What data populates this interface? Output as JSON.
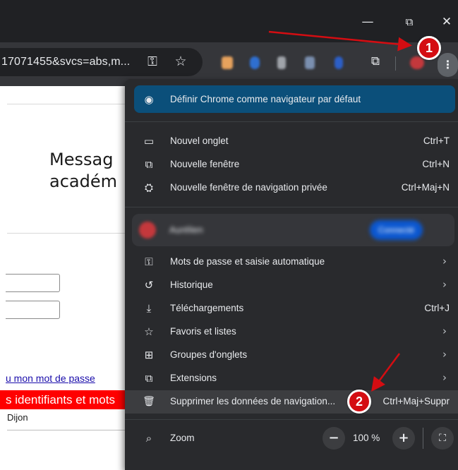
{
  "window": {
    "minimize_glyph": "—",
    "restore_glyph": "⧉",
    "close_glyph": "✕"
  },
  "toolbar": {
    "url_text": "17071455&svcs=abs,m...",
    "password_key_glyph": "⚿",
    "bookmark_star_glyph": "☆",
    "extensions_glyph": "⧉",
    "menu_glyph": "⋮"
  },
  "page": {
    "heading_line1": "Messag",
    "heading_line2": "académ",
    "forgot_link": "u mon mot de passe",
    "red_banner": "s identifiants et mots",
    "city": "Dijon"
  },
  "menu": {
    "set_default": {
      "label": "Définir Chrome comme navigateur par défaut",
      "icon": "chrome-icon",
      "glyph": "◉"
    },
    "group1": [
      {
        "label": "Nouvel onglet",
        "shortcut": "Ctrl+T",
        "icon": "new-tab-icon",
        "glyph": "▭"
      },
      {
        "label": "Nouvelle fenêtre",
        "shortcut": "Ctrl+N",
        "icon": "new-window-icon",
        "glyph": "⧉"
      },
      {
        "label": "Nouvelle fenêtre de navigation privée",
        "shortcut": "Ctrl+Maj+N",
        "icon": "incognito-icon",
        "glyph": "⛭"
      }
    ],
    "profile": {
      "name": "Aurélien",
      "status": "Connecté"
    },
    "group2": [
      {
        "label": "Mots de passe et saisie automatique",
        "icon": "key-icon",
        "glyph": "⚿",
        "chevron": "›"
      },
      {
        "label": "Historique",
        "icon": "history-icon",
        "glyph": "↺",
        "chevron": "›"
      },
      {
        "label": "Téléchargements",
        "shortcut": "Ctrl+J",
        "icon": "download-icon",
        "glyph": "⤓"
      },
      {
        "label": "Favoris et listes",
        "icon": "star-icon",
        "glyph": "☆",
        "chevron": "›"
      },
      {
        "label": "Groupes d'onglets",
        "icon": "tab-groups-icon",
        "glyph": "⊞",
        "chevron": "›"
      },
      {
        "label": "Extensions",
        "icon": "puzzle-icon",
        "glyph": "⧉",
        "chevron": "›"
      },
      {
        "label": "Supprimer les données de navigation...",
        "shortcut": "Ctrl+Maj+Suppr",
        "icon": "trash-icon",
        "glyph": "🗑"
      }
    ],
    "zoom": {
      "label": "Zoom",
      "value": "100 %",
      "minus": "−",
      "plus": "+",
      "fullscreen_glyph": "⛶",
      "icon": "zoom-icon",
      "glyph": "⌕"
    }
  },
  "annotations": {
    "badge1": "1",
    "badge2": "2",
    "color": "#d40d12"
  },
  "colors": {
    "banner": "#0b4f7a",
    "menu_bg": "#292a2d",
    "titlebar": "#202124",
    "toolbar": "#35363a",
    "red_banner": "#ff0000"
  }
}
